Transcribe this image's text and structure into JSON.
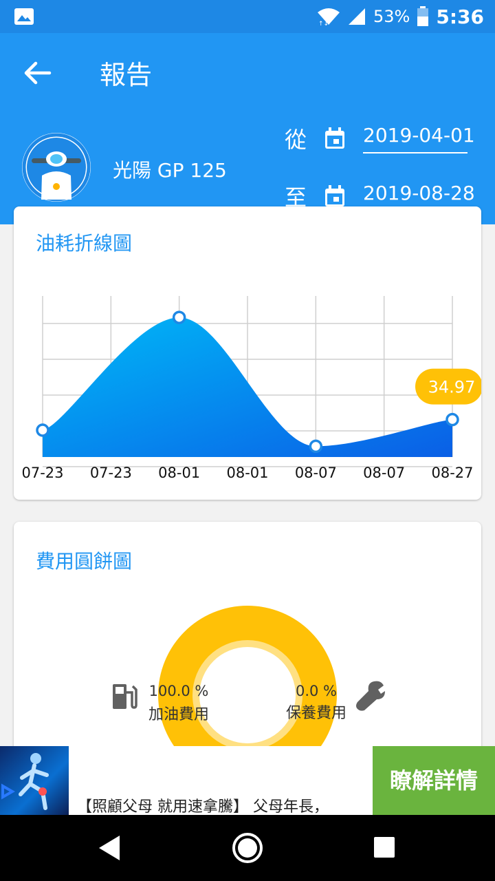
{
  "status_bar": {
    "battery_percent": "53%",
    "time": "5:36",
    "icons": [
      "image-icon",
      "wifi-icon",
      "signal-icon",
      "battery-icon"
    ]
  },
  "header": {
    "title": "報告",
    "vehicle_name": "光陽 GP 125",
    "from_label": "從",
    "from_date": "2019-04-01",
    "to_label": "至",
    "to_date": "2019-08-28",
    "background_color": "#2196f3"
  },
  "fuel_chart": {
    "title": "油耗折線圖",
    "highlight_label": "34.97"
  },
  "cost_chart": {
    "title": "費用圓餅圖",
    "fuel_percent": "100.0 %",
    "fuel_label": "加油費用",
    "maintenance_percent": "0.0 %",
    "maintenance_label": "保養費用"
  },
  "ad": {
    "text": "【照顧父母 就用速拿騰】 父母年長，",
    "cta": "瞭解詳情"
  },
  "chart_data": [
    {
      "type": "area",
      "title": "油耗折線圖",
      "categories": [
        "07-23",
        "07-23",
        "08-01",
        "08-01",
        "08-07",
        "08-07",
        "08-27"
      ],
      "x_point_index": [
        0,
        2,
        4,
        6
      ],
      "values": [
        33,
        54,
        30,
        34.97
      ],
      "ylim": [
        28,
        58
      ],
      "grid": true,
      "annotations": [
        {
          "x_index": 6,
          "text": "34.97"
        }
      ],
      "fill_gradient": [
        "#00b4f5",
        "#0a5fe6"
      ]
    },
    {
      "type": "pie",
      "title": "費用圓餅圖",
      "labels": [
        "加油費用",
        "保養費用"
      ],
      "values": [
        100.0,
        0.0
      ],
      "colors": [
        "#ffc107",
        "#ffe082"
      ]
    }
  ]
}
